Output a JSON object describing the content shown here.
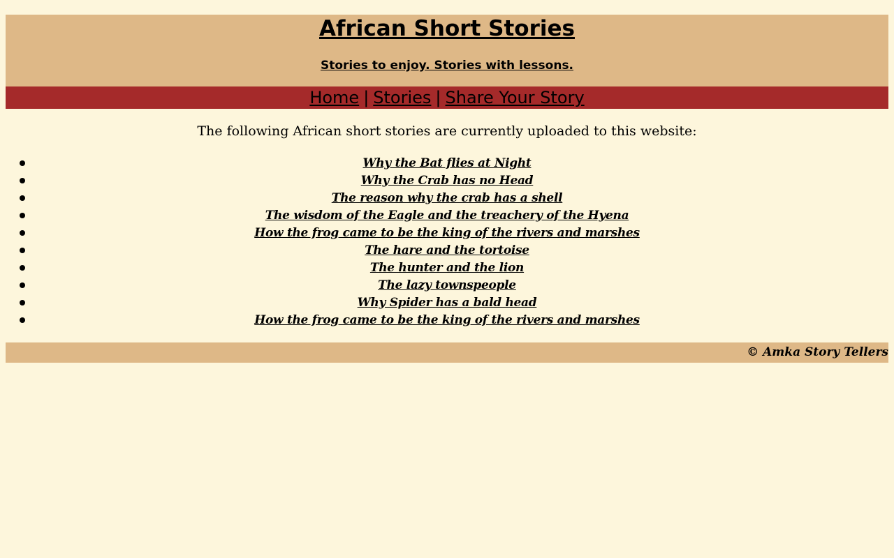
{
  "header": {
    "title": "African Short Stories",
    "tagline": "Stories to enjoy. Stories with lessons."
  },
  "nav": {
    "home": "Home",
    "stories": "Stories",
    "share": "Share Your Story",
    "separator": "|"
  },
  "main": {
    "intro": "The following African short stories are currently uploaded to this website:",
    "stories": [
      "Why the Bat flies at Night",
      "Why the Crab has no Head",
      "The reason why the crab has a shell",
      "The wisdom of the Eagle and the treachery of the Hyena",
      "How the frog came to be the king of the rivers and marshes",
      "The hare and the tortoise",
      "The hunter and the lion",
      "The lazy townspeople",
      "Why Spider has a bald head",
      "How the frog came to be the king of the rivers and marshes"
    ]
  },
  "footer": {
    "copyright": "© Amka Story Tellers"
  },
  "colors": {
    "page_background": "#fdf6dc",
    "header_background": "#deb887",
    "nav_background": "#a52a2a"
  }
}
